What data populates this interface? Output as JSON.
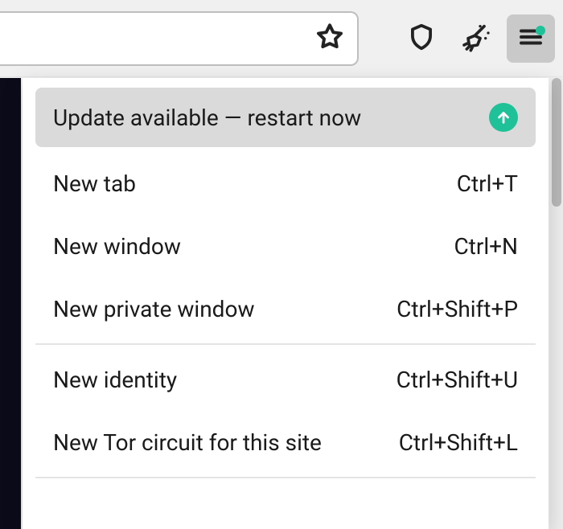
{
  "toolbar": {
    "star_icon": "star-icon",
    "shield_icon": "shield-icon",
    "broom_icon": "broom-icon",
    "hamburger_icon": "hamburger-icon",
    "update_dot_color": "#1fc198"
  },
  "menu": {
    "update": {
      "label": "Update available — restart now",
      "icon": "arrow-up-circle-icon",
      "icon_bg": "#1fc198"
    },
    "groups": [
      [
        {
          "label": "New tab",
          "shortcut": "Ctrl+T"
        },
        {
          "label": "New window",
          "shortcut": "Ctrl+N"
        },
        {
          "label": "New private window",
          "shortcut": "Ctrl+Shift+P"
        }
      ],
      [
        {
          "label": "New identity",
          "shortcut": "Ctrl+Shift+U"
        },
        {
          "label": "New Tor circuit for this site",
          "shortcut": "Ctrl+Shift+L"
        }
      ]
    ]
  }
}
